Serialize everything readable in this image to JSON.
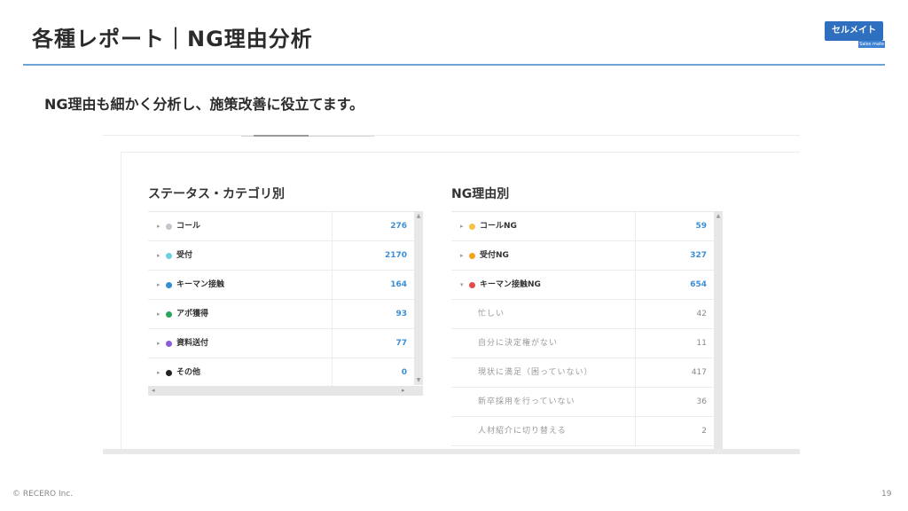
{
  "slide": {
    "title": "各種レポート｜NG理由分析",
    "subtitle": "NG理由も細かく分析し、施策改善に役立てます。",
    "footer": "© RECERO Inc.",
    "page_number": "19"
  },
  "logo": {
    "main": "セルメイト",
    "sub": "Sales mate"
  },
  "colors": {
    "accent_rule": "#6ea3d8",
    "value_blue": "#3b8fd6",
    "logo_blue": "#2e6fc0"
  },
  "status_panel": {
    "title": "ステータス・カテゴリ別",
    "rows": [
      {
        "label": "コール",
        "value": "276",
        "dot_color": "#c3c6cc"
      },
      {
        "label": "受付",
        "value": "2170",
        "dot_color": "#6dd0e2"
      },
      {
        "label": "キーマン接触",
        "value": "164",
        "dot_color": "#2f8fd0"
      },
      {
        "label": "アポ獲得",
        "value": "93",
        "dot_color": "#27a65a"
      },
      {
        "label": "資料送付",
        "value": "77",
        "dot_color": "#8a5cd8"
      },
      {
        "label": "その他",
        "value": "0",
        "dot_color": "#222222"
      }
    ]
  },
  "ng_panel": {
    "title": "NG理由別",
    "rows": [
      {
        "label": "コールNG",
        "value": "59",
        "dot_color": "#f5c242",
        "expanded": false
      },
      {
        "label": "受付NG",
        "value": "327",
        "dot_color": "#f2a21b",
        "expanded": false
      },
      {
        "label": "キーマン接触NG",
        "value": "654",
        "dot_color": "#e24b4b",
        "expanded": true
      }
    ],
    "sub_rows": [
      {
        "label": "忙しい",
        "value": "42"
      },
      {
        "label": "自分に決定権がない",
        "value": "11"
      },
      {
        "label": "現状に満足（困っていない）",
        "value": "417"
      },
      {
        "label": "新卒採用を行っていない",
        "value": "36"
      },
      {
        "label": "人材紹介に切り替える",
        "value": "2"
      }
    ]
  },
  "icons": {
    "collapsed": "▸",
    "expanded": "▾",
    "scroll_up": "▲",
    "scroll_down": "▼",
    "scroll_left": "◂",
    "scroll_right": "▸"
  }
}
